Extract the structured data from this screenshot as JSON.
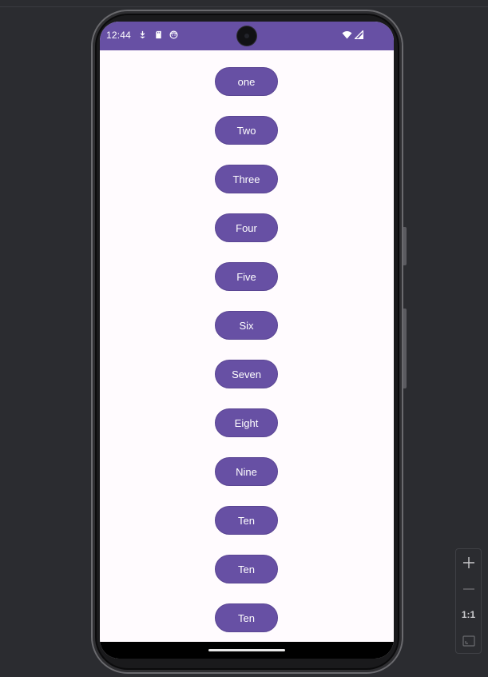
{
  "status_bar": {
    "time": "12:44",
    "icons": [
      "download-icon",
      "sd-card-icon",
      "face-icon",
      "wifi-icon",
      "signal-icon"
    ],
    "color": "#6750a4"
  },
  "buttons": [
    {
      "label": "one"
    },
    {
      "label": "Two"
    },
    {
      "label": "Three"
    },
    {
      "label": "Four"
    },
    {
      "label": "Five"
    },
    {
      "label": "Six"
    },
    {
      "label": "Seven"
    },
    {
      "label": "Eight"
    },
    {
      "label": "Nine"
    },
    {
      "label": "Ten"
    },
    {
      "label": "Ten"
    },
    {
      "label": "Ten"
    }
  ],
  "zoom_toolbar": {
    "zoom_in": "zoom-in-icon",
    "zoom_out": "zoom-out-icon",
    "actual_size_label": "1:1",
    "fit": "fit-screen-icon"
  },
  "colors": {
    "accent": "#6750a4",
    "background": "#fffbfe",
    "frame": "#1a1a1c",
    "emulator_bg": "#2b2c30"
  }
}
